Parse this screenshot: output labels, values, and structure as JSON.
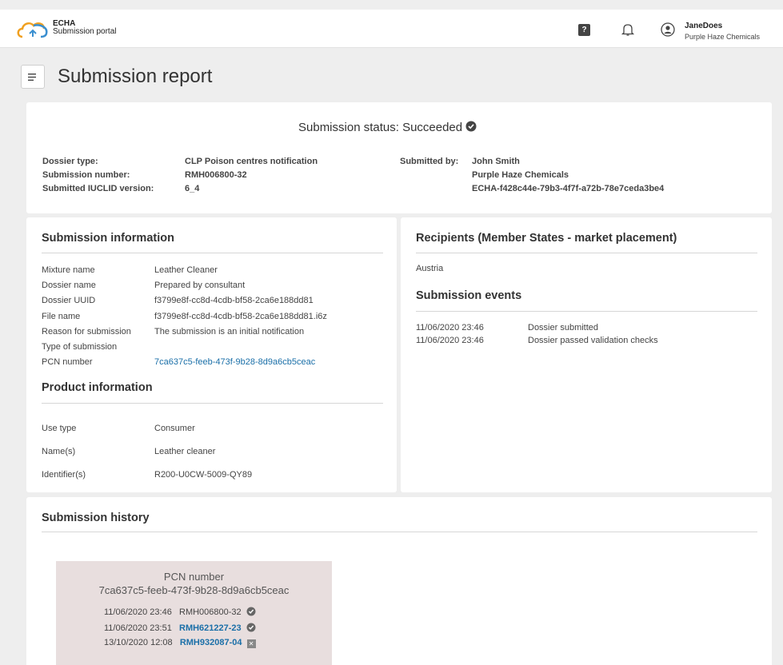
{
  "header": {
    "brand_line1": "ECHA",
    "brand_line2": "Submission portal",
    "help_label": "?",
    "user_name": "JaneDoes",
    "user_org": "Purple Haze Chemicals"
  },
  "page": {
    "title": "Submission report"
  },
  "status": {
    "label": "Submission status:",
    "value": "Succeeded",
    "left_labels": [
      "Dossier type:",
      "Submission number:",
      "Submitted IUCLID version:"
    ],
    "left_values": [
      "CLP Poison centres notification",
      "RMH006800-32",
      "6_4"
    ],
    "submitted_by_label": "Submitted by:",
    "submitted_by_values": [
      "John Smith",
      "Purple Haze Chemicals",
      "ECHA-f428c44e-79b3-4f7f-a72b-78e7ceda3be4"
    ]
  },
  "submission_info": {
    "title": "Submission information",
    "rows": [
      {
        "label": "Mixture name",
        "value": "Leather Cleaner"
      },
      {
        "label": "Dossier name",
        "value": "Prepared by consultant"
      },
      {
        "label": "Dossier UUID",
        "value": "f3799e8f-cc8d-4cdb-bf58-2ca6e188dd81"
      },
      {
        "label": "File name",
        "value": "f3799e8f-cc8d-4cdb-bf58-2ca6e188dd81.i6z"
      },
      {
        "label": "Reason for submission",
        "value": "The submission is an initial notification"
      },
      {
        "label": "Type of submission",
        "value": ""
      },
      {
        "label": "PCN number",
        "value": "7ca637c5-feeb-473f-9b28-8d9a6cb5ceac"
      }
    ]
  },
  "product_info": {
    "title": "Product information",
    "rows": [
      {
        "label": "Use type",
        "value": "Consumer"
      },
      {
        "label": "Name(s)",
        "value": "Leather cleaner"
      },
      {
        "label": "Identifier(s)",
        "value": "R200-U0CW-5009-QY89"
      }
    ]
  },
  "recipients": {
    "title": "Recipients (Member States - market placement)",
    "items": [
      "Austria"
    ]
  },
  "events": {
    "title": "Submission events",
    "rows": [
      {
        "date": "11/06/2020 23:46",
        "event": "Dossier submitted"
      },
      {
        "date": "11/06/2020 23:46",
        "event": "Dossier passed validation checks"
      }
    ]
  },
  "history": {
    "title": "Submission history",
    "pcn_label": "PCN number",
    "pcn_value": "7ca637c5-feeb-473f-9b28-8d9a6cb5ceac",
    "rows": [
      {
        "date": "11/06/2020 23:46",
        "number": "RMH006800-32",
        "status_icon": "check-circle-icon"
      },
      {
        "date": "11/06/2020 23:51",
        "number": "RMH621227-23",
        "status_icon": "check-circle-icon"
      },
      {
        "date": "13/10/2020 12:08",
        "number": "RMH932087-04",
        "status_icon": "x-box-icon"
      }
    ]
  },
  "colors": {
    "link": "#1a6fa8",
    "pcn_box_bg": "#e8dede",
    "page_bg": "#eeeeee"
  }
}
